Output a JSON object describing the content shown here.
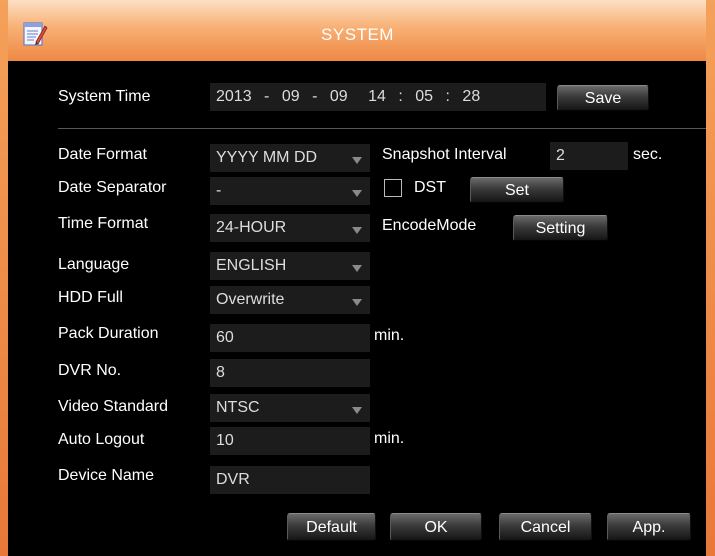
{
  "window": {
    "title": "SYSTEM",
    "icon": "notepad-edit-icon"
  },
  "system_time": {
    "label": "System Time",
    "year": "2013",
    "sep1": "-",
    "month": "09",
    "sep2": "-",
    "day": "09",
    "hour": "14",
    "sep3": ":",
    "minute": "05",
    "sep4": ":",
    "second": "28",
    "save_label": "Save"
  },
  "settings": {
    "date_format": {
      "label": "Date Format",
      "value": "YYYY MM DD"
    },
    "date_separator": {
      "label": "Date Separator",
      "value": "-"
    },
    "time_format": {
      "label": "Time Format",
      "value": "24-HOUR"
    },
    "language": {
      "label": "Language",
      "value": "ENGLISH"
    },
    "hdd_full": {
      "label": "HDD Full",
      "value": "Overwrite"
    },
    "pack_duration": {
      "label": "Pack Duration",
      "value": "60",
      "unit": "min."
    },
    "dvr_no": {
      "label": "DVR No.",
      "value": "8"
    },
    "video_standard": {
      "label": "Video Standard",
      "value": "NTSC"
    },
    "auto_logout": {
      "label": "Auto Logout",
      "value": "10",
      "unit": "min."
    },
    "device_name": {
      "label": "Device Name",
      "value": "DVR"
    }
  },
  "right_panel": {
    "snapshot_interval": {
      "label": "Snapshot Interval",
      "value": "2",
      "unit": "sec."
    },
    "dst": {
      "label": "DST",
      "checked": false,
      "set_label": "Set"
    },
    "encode_mode": {
      "label": "EncodeMode",
      "button_label": "Setting"
    }
  },
  "footer": {
    "default_label": "Default",
    "ok_label": "OK",
    "cancel_label": "Cancel",
    "apply_label": "App."
  },
  "colors": {
    "title_gradient_top": "#fce0c4",
    "title_gradient_bottom": "#ee8844",
    "frame": "#e8783a",
    "background": "#000000",
    "field_bg": "#1c1c1c"
  }
}
